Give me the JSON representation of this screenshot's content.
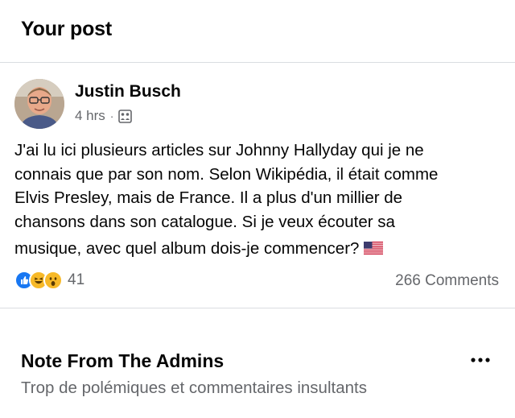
{
  "header": {
    "title": "Your post"
  },
  "post": {
    "author": "Justin Busch",
    "time": "4 hrs",
    "separator": "·",
    "audience_icon": "group-icon",
    "text_lines": [
      "J'ai lu ici plusieurs articles sur Johnny Hallyday qui je ne",
      "connais que par son nom. Selon Wikipédia, il était comme",
      "Elvis Presley, mais de France. Il a plus d'un millier de",
      "chansons dans son catalogue. Si je veux écouter sa",
      "musique, avec quel album dois-je commencer?"
    ],
    "flag_emoji": "us-flag",
    "reactions": {
      "types": [
        "like",
        "haha",
        "wow"
      ],
      "count": "41"
    },
    "comments": "266 Comments"
  },
  "admins": {
    "title": "Note From The Admins",
    "subtitle": "Trop de polémiques et commentaires insultants",
    "menu_icon": "more-icon"
  },
  "colors": {
    "text": "#050505",
    "secondary": "#65676b",
    "divider": "#dadde1",
    "like_blue": "#1877f2",
    "emoji_yellow": "#f7b928"
  }
}
